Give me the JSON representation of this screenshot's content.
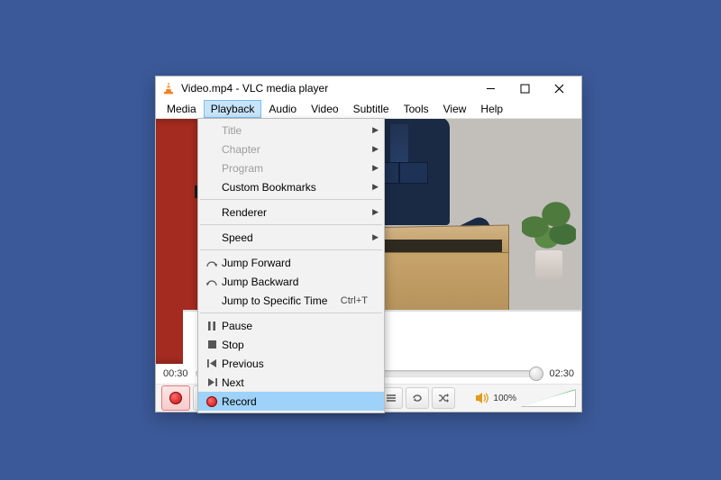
{
  "window": {
    "title": "Video.mp4 - VLC media player"
  },
  "menubar": {
    "items": [
      "Media",
      "Playback",
      "Audio",
      "Video",
      "Subtitle",
      "Tools",
      "View",
      "Help"
    ],
    "active_index": 1
  },
  "dropdown": {
    "title": {
      "label": "Title"
    },
    "chapter": {
      "label": "Chapter"
    },
    "program": {
      "label": "Program"
    },
    "custom_bookmarks": {
      "label": "Custom Bookmarks"
    },
    "renderer": {
      "label": "Renderer"
    },
    "speed": {
      "label": "Speed"
    },
    "jump_forward": {
      "label": "Jump Forward"
    },
    "jump_backward": {
      "label": "Jump Backward"
    },
    "jump_specific": {
      "label": "Jump to Specific Time",
      "shortcut": "Ctrl+T"
    },
    "pause": {
      "label": "Pause"
    },
    "stop": {
      "label": "Stop"
    },
    "previous": {
      "label": "Previous"
    },
    "next": {
      "label": "Next"
    },
    "record": {
      "label": "Record"
    }
  },
  "seek": {
    "current": "00:30",
    "total": "02:30"
  },
  "volume": {
    "label": "100%"
  }
}
